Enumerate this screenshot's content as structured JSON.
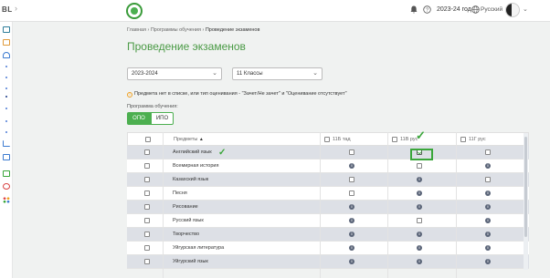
{
  "topbar": {
    "brand": "BL",
    "year_label": "2023-24 год",
    "language": "Русский"
  },
  "breadcrumb": {
    "items": [
      "Главная",
      "Программы обучения",
      "Проведение экзаменов"
    ]
  },
  "page_title": "Проведение экзаменов",
  "filters": {
    "year_select": "2023-2024",
    "class_select": "11 Классы"
  },
  "note": "Предмета нет в списке, или тип оценивания - \"Зачет/Не зачет\" и \"Оценивание отсутствует\"",
  "program_label": "Программа обучения:",
  "program_toggle": {
    "option1": "ОПО",
    "option2": "ИПО",
    "selected": "ОПО"
  },
  "table": {
    "headers": {
      "subjects": "Предметы",
      "sort_mark": "▲",
      "col1": "11Б тад",
      "col2": "11В рус",
      "col3": "11Г рус"
    },
    "rows": [
      {
        "subject": "Английский язык",
        "cells": [
          "checkbox",
          "checkbox-checked",
          "checkbox"
        ]
      },
      {
        "subject": "Всемирная история",
        "cells": [
          "info",
          "checkbox",
          "info"
        ]
      },
      {
        "subject": "Казахский язык",
        "cells": [
          "checkbox",
          "info",
          "checkbox"
        ]
      },
      {
        "subject": "Песня",
        "cells": [
          "checkbox",
          "info",
          "info"
        ]
      },
      {
        "subject": "Рисование",
        "cells": [
          "info",
          "info",
          "info"
        ]
      },
      {
        "subject": "Русский язык",
        "cells": [
          "info",
          "checkbox",
          "info"
        ]
      },
      {
        "subject": "Творчество",
        "cells": [
          "info",
          "info",
          "info"
        ]
      },
      {
        "subject": "Уйгурская литература",
        "cells": [
          "info",
          "info",
          "info"
        ]
      },
      {
        "subject": "Уйгурский язык",
        "cells": [
          "info",
          "info",
          "info"
        ]
      }
    ]
  },
  "colors": {
    "accent_green": "#4caf50",
    "title_green": "#4a9a45",
    "row_alt": "#dde0e6",
    "info_icon": "#5a6478"
  }
}
